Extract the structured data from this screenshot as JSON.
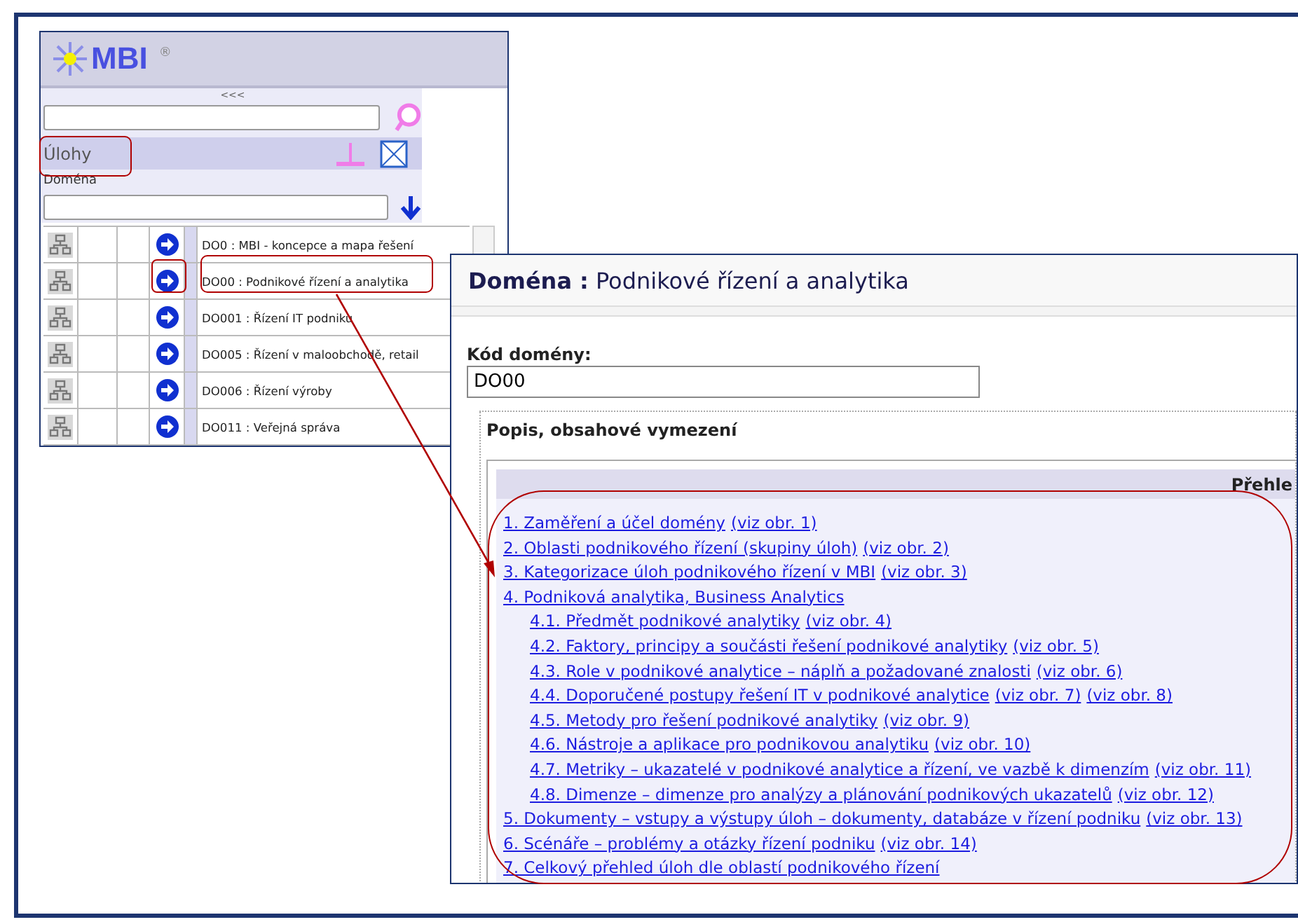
{
  "left_window": {
    "logo": "MBI",
    "logo_mark": "®",
    "collapse": "<<<",
    "section": "Úlohy",
    "filter_label": "Doména",
    "rows": [
      {
        "label": "DO0 : MBI - koncepce a mapa řešení"
      },
      {
        "label": "DO00 : Podnikové řízení a analytika"
      },
      {
        "label": "DO001 : Řízení IT podniku"
      },
      {
        "label": "DO005 : Řízení v maloobchodě, retail"
      },
      {
        "label": "DO006 : Řízení výroby"
      },
      {
        "label": "DO011 : Veřejná správa"
      }
    ]
  },
  "detail_window": {
    "title_label": "Doména :",
    "title": "Podnikové řízení a analytika",
    "code_label": "Kód domény:",
    "code": "DO00",
    "section_title": "Popis, obsahové vymezení",
    "overview_header": "Přehle",
    "toc": [
      {
        "text": "1. Zaměření a účel domény",
        "refs": [
          "(viz obr. 1)"
        ]
      },
      {
        "text": "2. Oblasti podnikového řízení (skupiny úloh)",
        "refs": [
          "(viz obr. 2)"
        ]
      },
      {
        "text": "3. Kategorizace úloh podnikového řízení v MBI",
        "refs": [
          "(viz obr. 3)"
        ]
      },
      {
        "text": "4. Podniková analytika, Business Analytics",
        "children": [
          {
            "text": "4.1. Předmět podnikové analytiky",
            "refs": [
              "(viz obr. 4)"
            ]
          },
          {
            "text": "4.2. Faktory, principy a součásti řešení podnikové analytiky",
            "refs": [
              "(viz obr. 5)"
            ]
          },
          {
            "text": "4.3. Role v podnikové analytice – náplň a požadované znalosti",
            "refs": [
              "(viz obr. 6)"
            ]
          },
          {
            "text": "4.4. Doporučené postupy řešení IT v podnikové analytice",
            "refs": [
              "(viz obr. 7)",
              "(viz obr. 8)"
            ]
          },
          {
            "text": "4.5. Metody pro řešení podnikové analytiky",
            "refs": [
              "(viz obr. 9)"
            ]
          },
          {
            "text": "4.6. Nástroje a aplikace pro podnikovou analytiku",
            "refs": [
              "(viz obr. 10)"
            ]
          },
          {
            "text": "4.7. Metriky – ukazatelé v podnikové analytice a řízení, ve vazbě k dimenzím",
            "refs": [
              "(viz obr. 11)"
            ]
          },
          {
            "text": "4.8. Dimenze – dimenze pro analýzy a plánování podnikových ukazatelů",
            "refs": [
              "(viz obr. 12)"
            ]
          }
        ]
      },
      {
        "text": "5. Dokumenty – vstupy a výstupy úloh – dokumenty, databáze v řízení podniku",
        "refs": [
          "(viz obr. 13)"
        ]
      },
      {
        "text": "6. Scénáře – problémy a otázky řízení podniku",
        "refs": [
          "(viz obr. 14)"
        ]
      },
      {
        "text": "7. Celkový přehled úloh dle oblastí podnikového řízení"
      }
    ]
  }
}
